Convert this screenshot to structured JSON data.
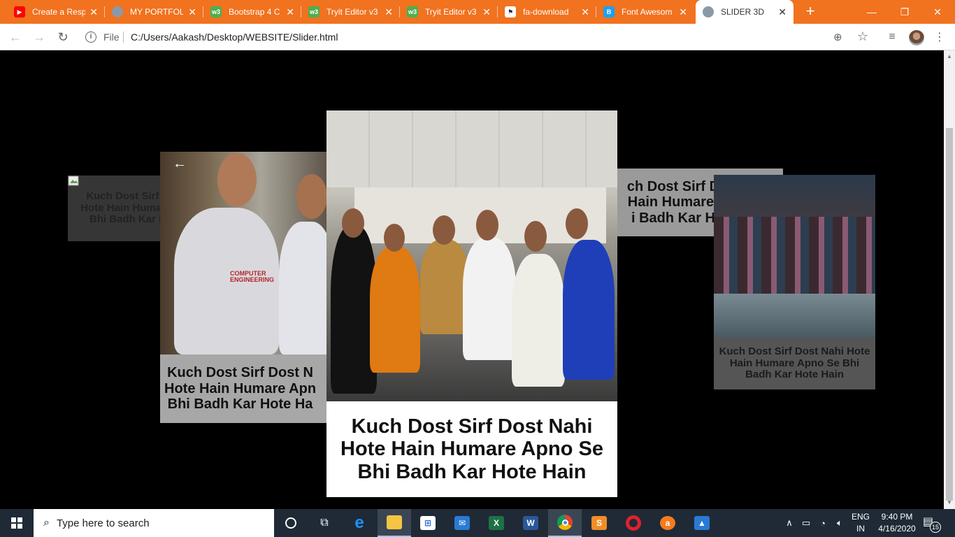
{
  "browser": {
    "tabs": [
      {
        "title": "Create a Resp",
        "icon": "youtube-icon",
        "color": "#ff0000"
      },
      {
        "title": "MY PORTFOL",
        "icon": "globe-icon",
        "color": "#6b7b8c"
      },
      {
        "title": "Bootstrap 4 C",
        "icon": "w3schools-icon",
        "color": "#4caf50"
      },
      {
        "title": "Tryit Editor v3",
        "icon": "w3schools-icon",
        "color": "#4caf50"
      },
      {
        "title": "Tryit Editor v3",
        "icon": "w3schools-icon",
        "color": "#4caf50"
      },
      {
        "title": "fa-download",
        "icon": "flag-icon",
        "color": "#222222"
      },
      {
        "title": "Font Awesom",
        "icon": "b-icon",
        "color": "#1da1f2"
      },
      {
        "title": "SLIDER 3D",
        "icon": "globe-icon",
        "color": "#6b7b8c",
        "active": true
      }
    ],
    "address": {
      "scheme_label": "File",
      "url": "C:/Users/Aakash/Desktop/WEBSITE/Slider.html"
    },
    "accent": "#f1721f"
  },
  "slider": {
    "caption": "Kuch Dost Sirf Dost Nahi Hote Hain Humare Apno Se Bhi Badh Kar Hote Hain",
    "caption_lines": [
      "Kuch Dost Sirf Dost Nahi",
      "Hote Hain Humare Apno Se",
      "Bhi Badh Kar Hote Hain"
    ],
    "left_caption_lines": [
      "Kuch Dost Sirf Dost N",
      "Hote Hain Humare Apn",
      "Bhi Badh Kar Hote Ha"
    ],
    "right_caption_lines": [
      "ch Dost Sirf Dost Nahi",
      "Hain Humare Apno Se",
      "i Badh Kar Hote Hain"
    ],
    "prev_arrow": "←",
    "tshirt_text_1": "COMPUTER ENGINEERING",
    "tshirt_text_2": "COMPUTER ENGINEERING"
  },
  "taskbar": {
    "search_placeholder": "Type here to search",
    "apps": [
      {
        "name": "cortana-icon"
      },
      {
        "name": "task-view-icon"
      },
      {
        "name": "edge-icon"
      },
      {
        "name": "file-explorer-icon"
      },
      {
        "name": "store-icon"
      },
      {
        "name": "mail-icon"
      },
      {
        "name": "excel-icon"
      },
      {
        "name": "word-icon"
      },
      {
        "name": "chrome-icon"
      },
      {
        "name": "sublime-icon"
      },
      {
        "name": "opera-icon"
      },
      {
        "name": "avast-icon"
      },
      {
        "name": "photos-icon"
      }
    ],
    "lang_line1": "ENG",
    "lang_line2": "IN",
    "time": "9:40 PM",
    "date": "4/16/2020",
    "notification_count": "15"
  }
}
